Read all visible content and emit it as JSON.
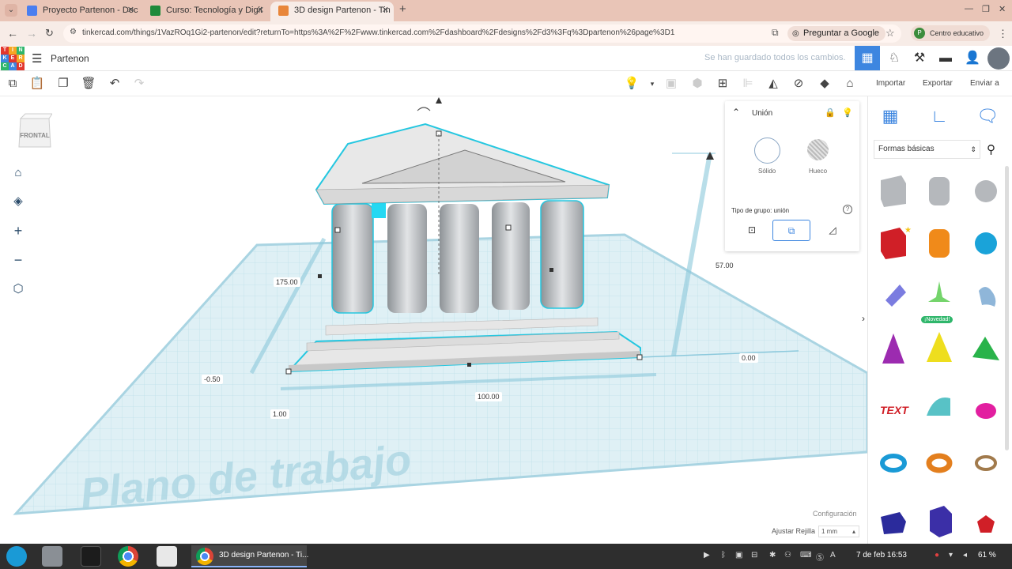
{
  "browser": {
    "tabs": [
      {
        "title": "Proyecto Partenon - Doc",
        "favicon_color": "#4a7ef0"
      },
      {
        "title": "Curso: Tecnología y Digit",
        "favicon_color": "#1f8a3b"
      },
      {
        "title": "3D design Partenon - Tin",
        "favicon_color": "#e8863a"
      }
    ],
    "url": "tinkercad.com/things/1VazROq1Gi2-partenon/edit?returnTo=https%3A%2F%2Fwww.tinkercad.com%2Fdashboard%2Fdesigns%2Fd3%3Fq%3Dpartenon%26page%3D1",
    "ask_google": "Preguntar a Google",
    "profile_label": "Centro educativo",
    "profile_initial": "P"
  },
  "app": {
    "logo_letters": [
      "T",
      "I",
      "N",
      "K",
      "E",
      "R",
      "C",
      "A",
      "D"
    ],
    "logo_colors": [
      "#e2372e",
      "#f5a623",
      "#2fb66b",
      "#3d86e0",
      "#e2372e",
      "#f5a623",
      "#2fb66b",
      "#3d86e0",
      "#e2372e"
    ],
    "design_title": "Partenon",
    "saved_msg": "Se han guardado todos los cambios."
  },
  "toolbar": {
    "import": "Importar",
    "export": "Exportar",
    "send_to": "Enviar a"
  },
  "viewport": {
    "viewcube_label": "FRONTAL",
    "workplane_label": "Plano de trabajo",
    "dims": {
      "depth": "175.00",
      "height": "57.00",
      "width": "100.00",
      "elevation": "0.00",
      "offset_x": "-0.50",
      "offset_y": "1.00"
    },
    "settings": "Configuración",
    "snap_label": "Ajustar Rejilla",
    "snap_value": "1 mm"
  },
  "inspector": {
    "title": "Unión",
    "solid": "Sólido",
    "hole": "Hueco",
    "group_type": "Tipo de grupo: unión"
  },
  "shapes_panel": {
    "category": "Formas básicas",
    "new_badge": "¡Novedad!"
  },
  "taskbar": {
    "window_title": "3D design Partenon - Ti...",
    "clock": "7 de feb  16:53",
    "battery": "61 %"
  }
}
